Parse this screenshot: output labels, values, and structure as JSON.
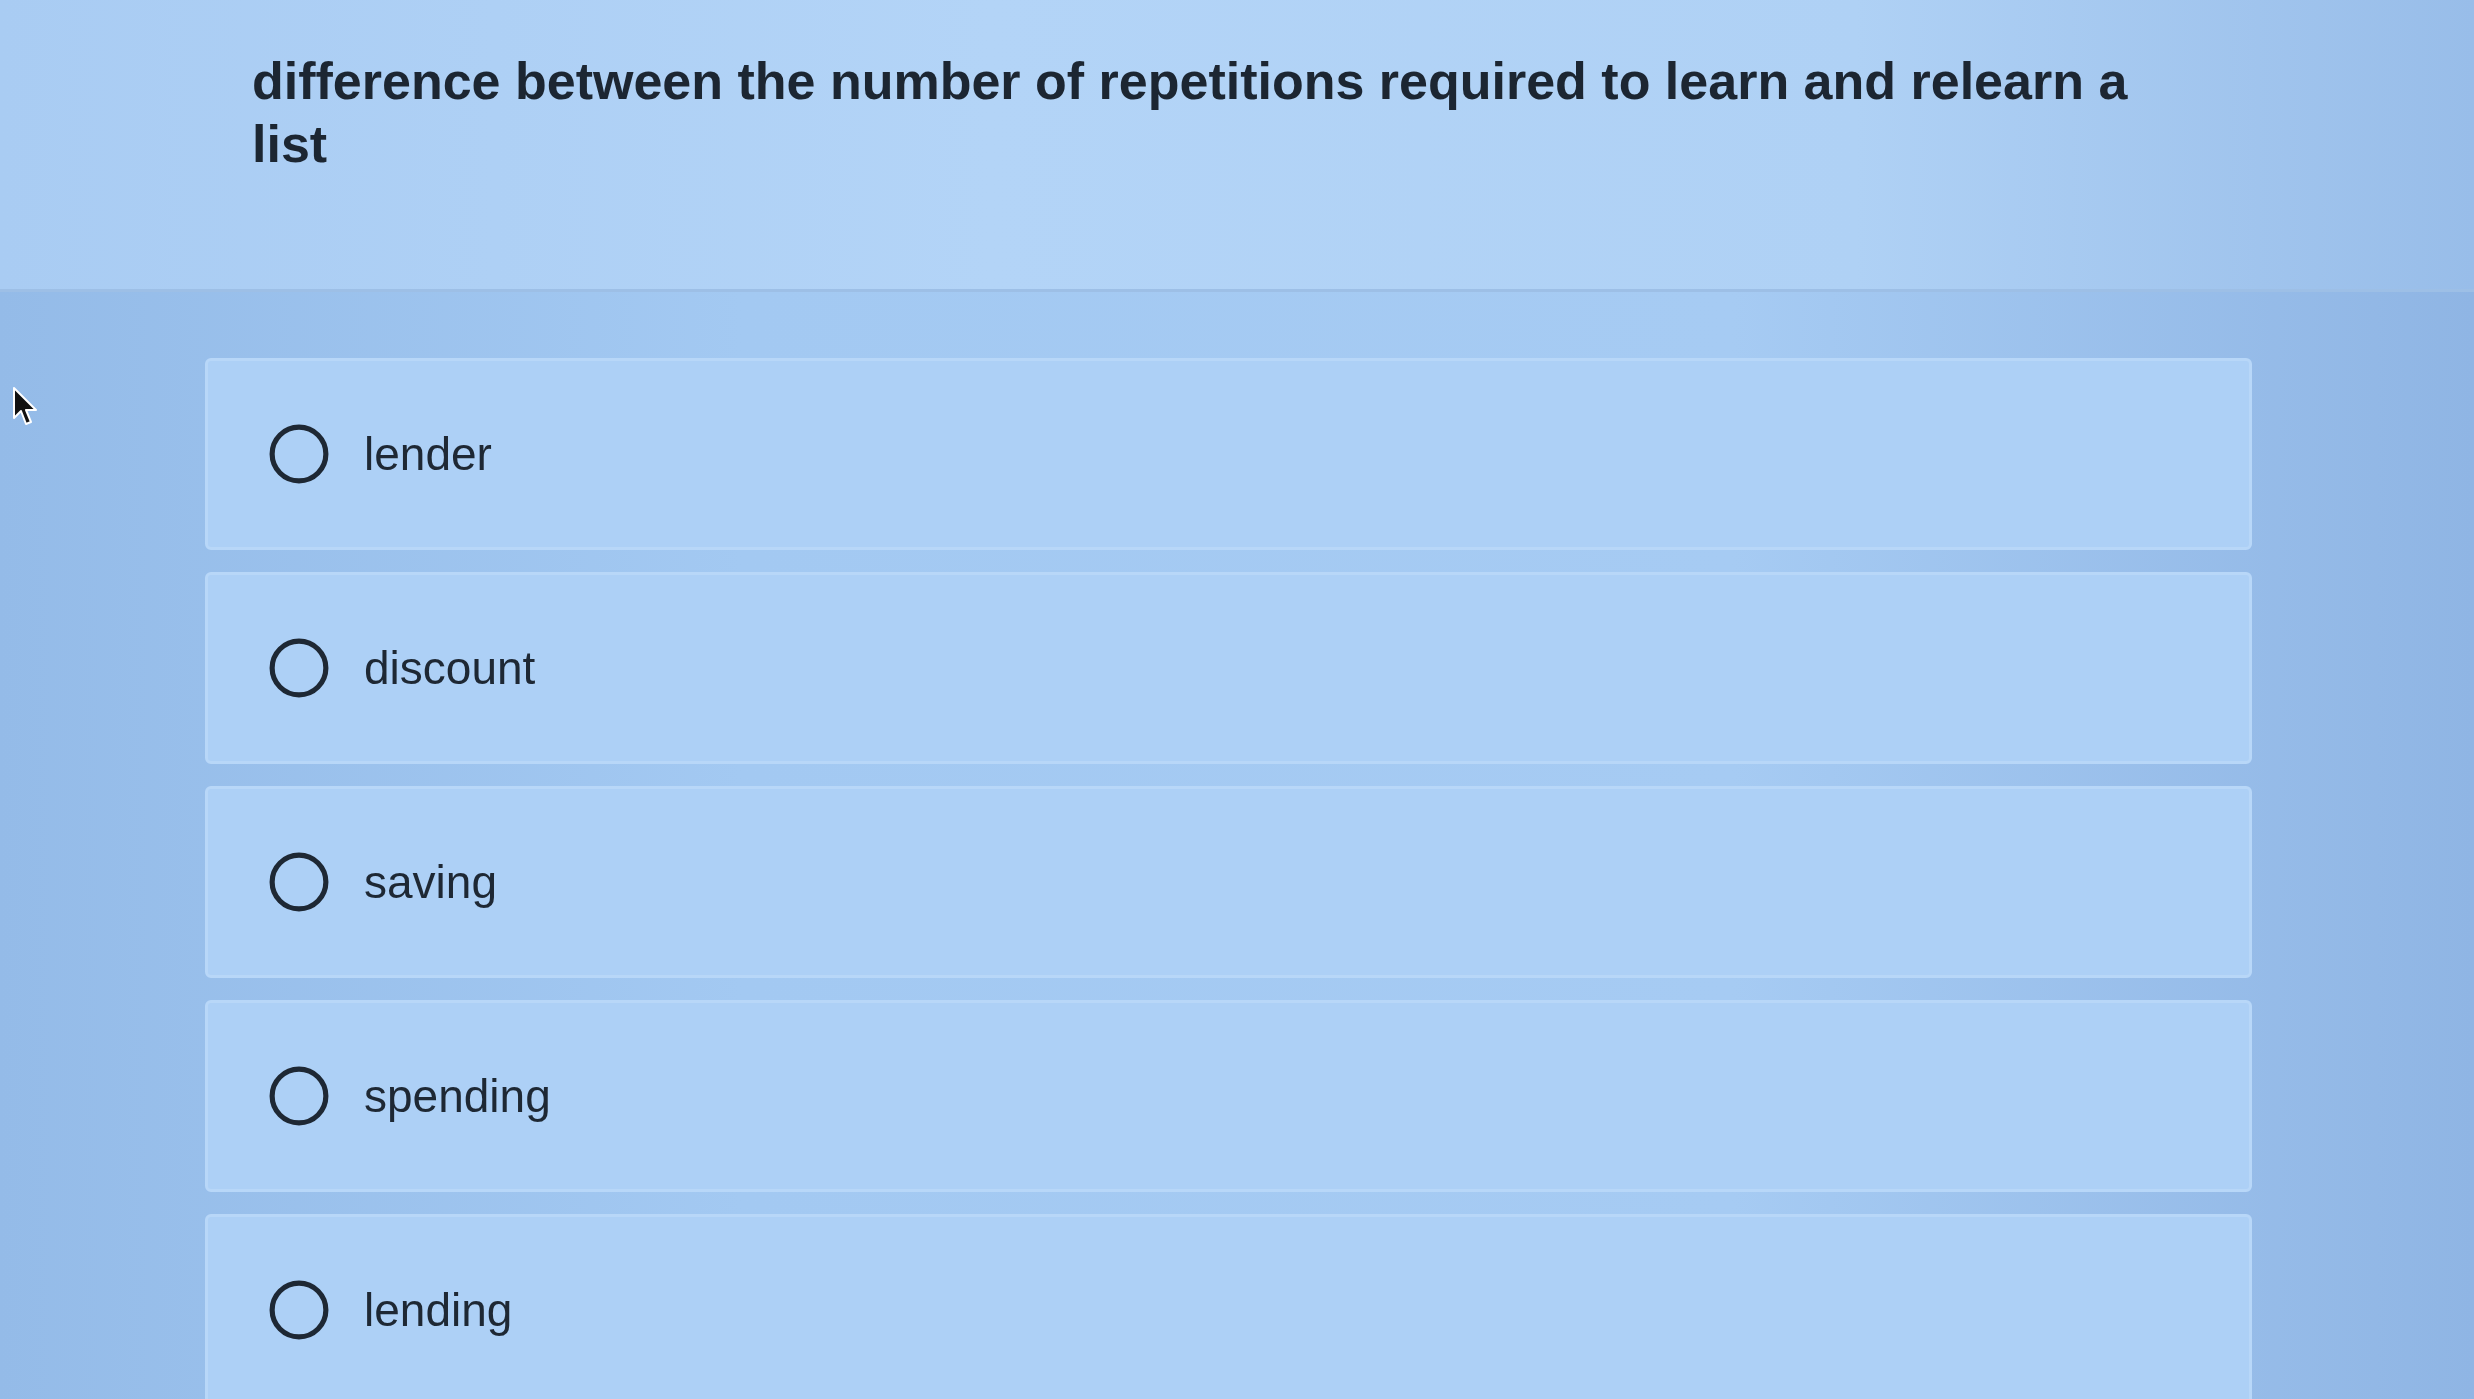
{
  "question": {
    "text": "difference between the number of repetitions required to learn and relearn a list"
  },
  "options": [
    {
      "label": "lender",
      "selected": false
    },
    {
      "label": "discount",
      "selected": false
    },
    {
      "label": "saving",
      "selected": false
    },
    {
      "label": "spending",
      "selected": false
    },
    {
      "label": "lending",
      "selected": false
    }
  ]
}
